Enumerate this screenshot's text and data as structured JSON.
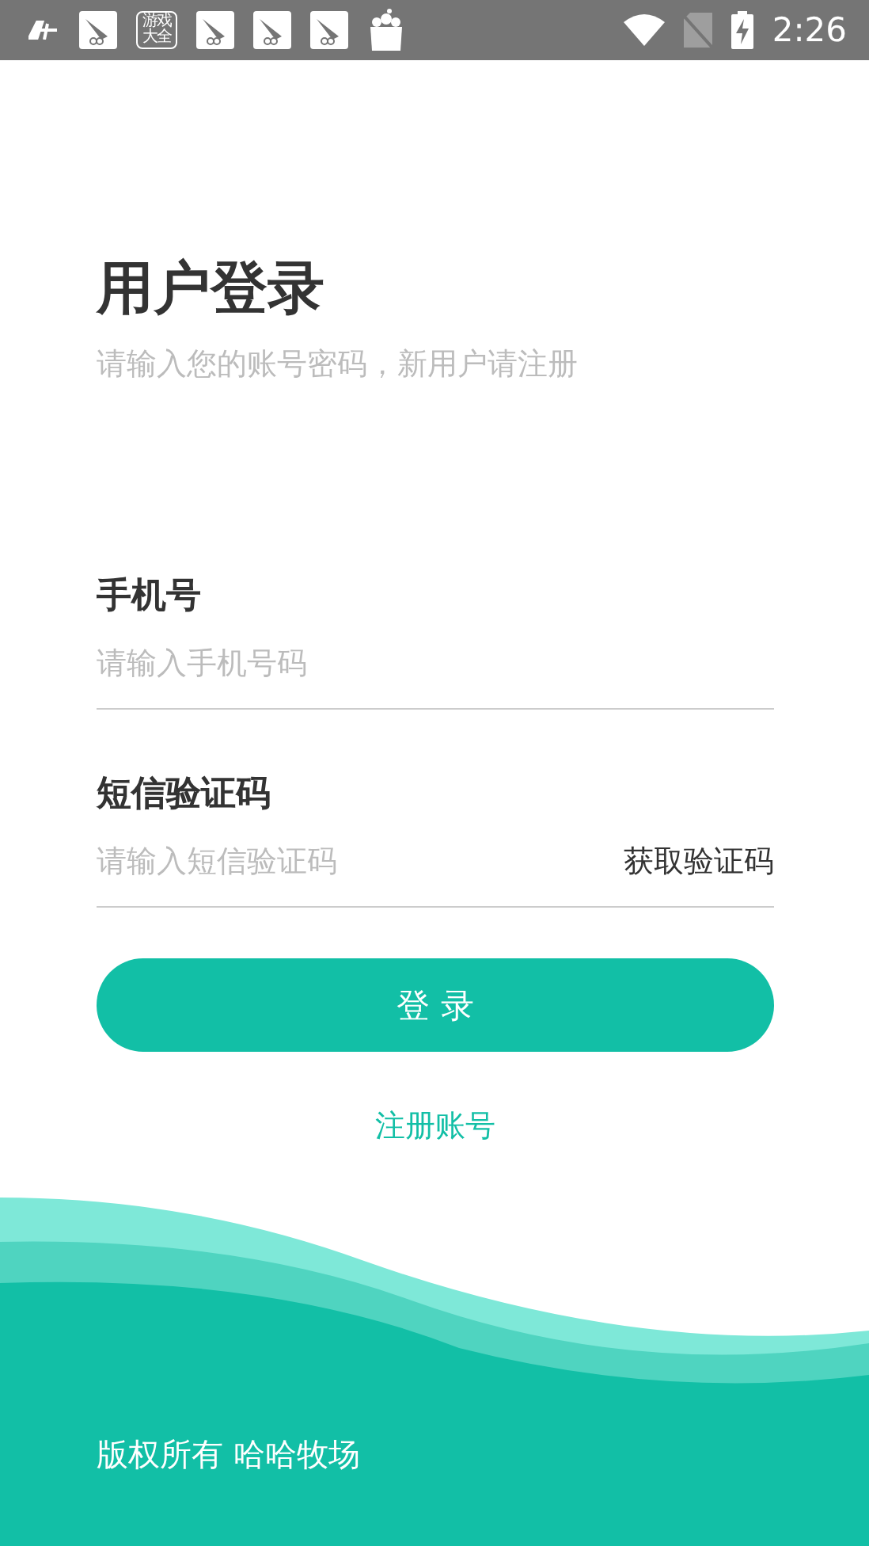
{
  "status_bar": {
    "notifications": [
      {
        "kind": "app"
      },
      {
        "kind": "badge",
        "text": "游戏大全"
      },
      {
        "kind": "app"
      },
      {
        "kind": "app"
      },
      {
        "kind": "app"
      },
      {
        "kind": "bag"
      }
    ],
    "time": "2:26"
  },
  "title": "用户登录",
  "subtitle": "请输入您的账号密码，新用户请注册",
  "fields": [
    {
      "label": "手机号",
      "placeholder": "请输入手机号码"
    },
    {
      "label": "短信验证码",
      "placeholder": "请输入短信验证码",
      "action": "获取验证码"
    }
  ],
  "login_button": "登 录",
  "register_link": "注册账号",
  "footer": "版权所有 哈哈牧场"
}
